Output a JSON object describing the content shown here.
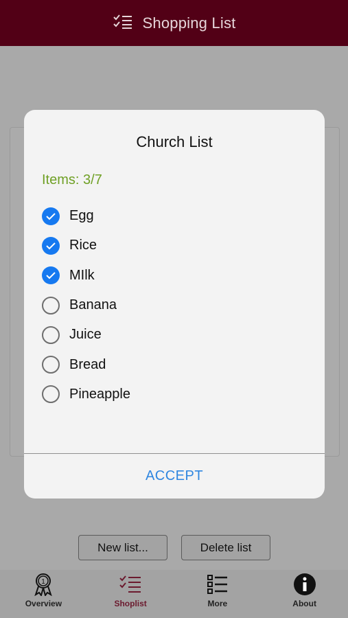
{
  "header": {
    "title": "Shopping List",
    "icon": "checklist-icon"
  },
  "dialog": {
    "title": "Church List",
    "items_count": "Items: 3/7",
    "items": [
      {
        "label": "Egg",
        "checked": true
      },
      {
        "label": "Rice",
        "checked": true
      },
      {
        "label": "MIlk",
        "checked": true
      },
      {
        "label": "Banana",
        "checked": false
      },
      {
        "label": "Juice",
        "checked": false
      },
      {
        "label": "Bread",
        "checked": false
      },
      {
        "label": "Pineapple",
        "checked": false
      }
    ],
    "accept_label": "ACCEPT"
  },
  "buttons": {
    "new_list": "New list...",
    "delete_list": "Delete list"
  },
  "tabs": [
    {
      "label": "Overview",
      "icon": "award-icon",
      "active": false
    },
    {
      "label": "Shoplist",
      "icon": "checklist-icon",
      "active": true
    },
    {
      "label": "More",
      "icon": "list-icon",
      "active": false
    },
    {
      "label": "About",
      "icon": "info-icon",
      "active": false
    }
  ],
  "colors": {
    "header": "#520016",
    "accent": "#1679f0",
    "count": "#6fa025",
    "accept": "#2f86e0",
    "active_tab": "#6b1a2e"
  }
}
